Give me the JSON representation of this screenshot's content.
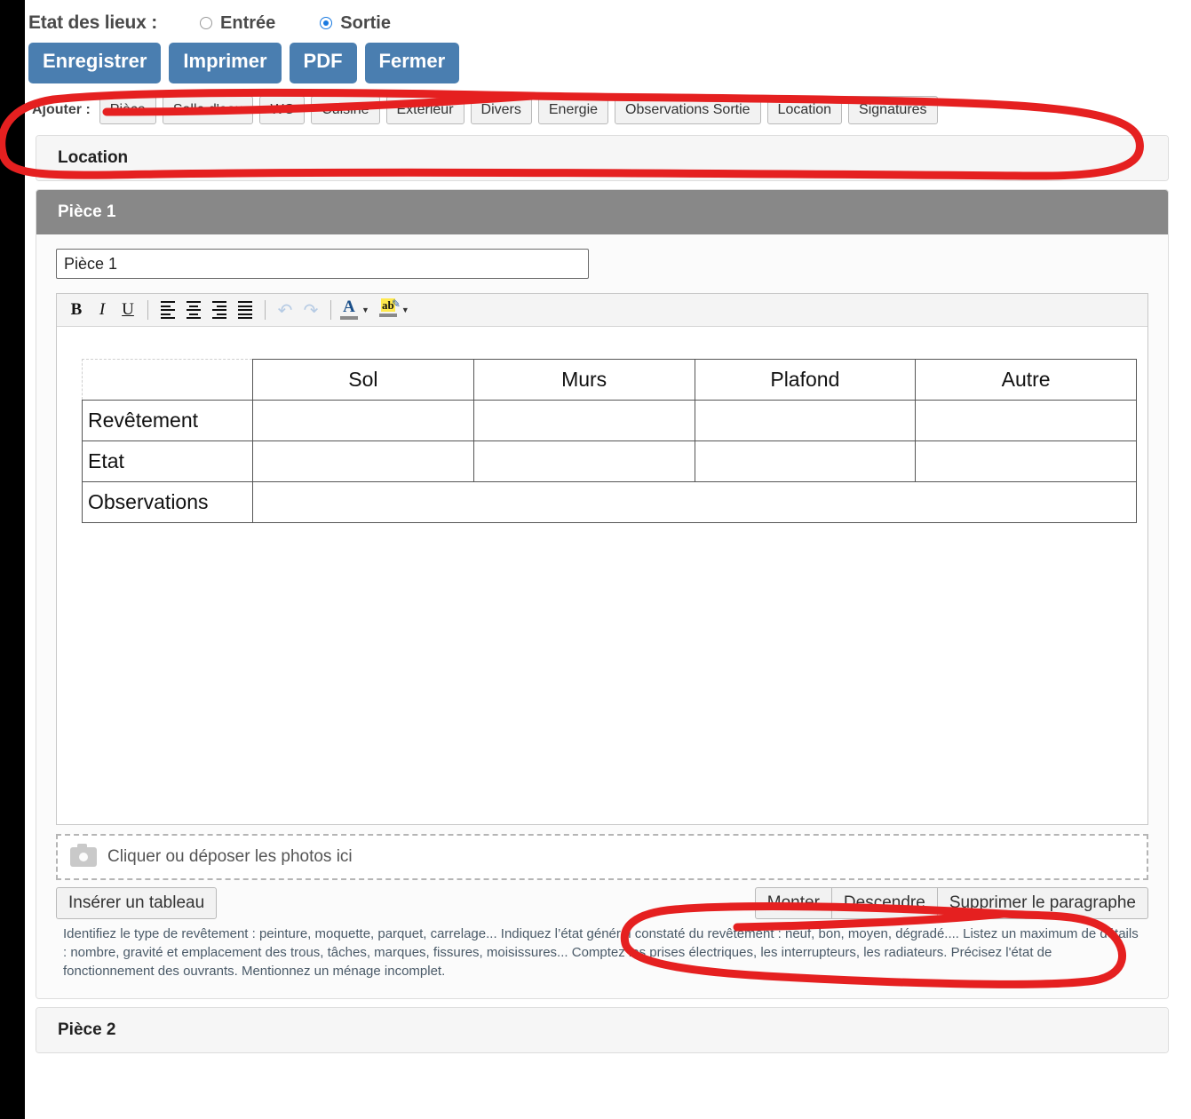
{
  "header": {
    "title": "Etat des lieux :",
    "radios": [
      {
        "label": "Entrée",
        "checked": false
      },
      {
        "label": "Sortie",
        "checked": true
      }
    ]
  },
  "actions": {
    "buttons": [
      "Enregistrer",
      "Imprimer",
      "PDF",
      "Fermer"
    ]
  },
  "add_bar": {
    "label": "Ajouter :",
    "buttons": [
      "Pièce",
      "Salle d'eau",
      "WC",
      "Cuisine",
      "Extérieur",
      "Divers",
      "Energie",
      "Observations Sortie",
      "Location",
      "Signatures"
    ]
  },
  "sections": {
    "location_title": "Location",
    "piece1_title": "Pièce 1",
    "piece2_title": "Pièce 2"
  },
  "piece1": {
    "name_value": "Pièce 1",
    "toolbar": {
      "bold": "B",
      "italic": "I",
      "underline": "U",
      "undo": "↶",
      "redo": "↷",
      "font_color_glyph": "A",
      "highlight_glyph": "ab",
      "dropdown_arrow": "▼"
    },
    "table": {
      "columns": [
        "",
        "Sol",
        "Murs",
        "Plafond",
        "Autre"
      ],
      "rows": [
        {
          "header": "Revêtement",
          "cells": [
            "",
            "",
            "",
            ""
          ]
        },
        {
          "header": "Etat",
          "cells": [
            "",
            "",
            "",
            ""
          ]
        },
        {
          "header": "Observations",
          "cells": [
            ""
          ]
        }
      ]
    },
    "dropzone_text": "Cliquer ou déposer les photos ici",
    "insert_table_label": "Insérer un tableau",
    "move_up_label": "Monter",
    "move_down_label": "Descendre",
    "delete_label": "Supprimer le paragraphe",
    "help_text": "Identifiez le type de revêtement : peinture, moquette, parquet, carrelage... Indiquez l’état général constaté du revêtement : neuf, bon, moyen, dégradé.... Listez un maximum de détails : nombre, gravité et emplacement des trous, tâches, marques, fissures, moisissures... Comptez les prises électriques, les interrupteurs, les radiateurs. Précisez l'état de fonctionnement des ouvrants. Mentionnez un ménage incomplet."
  },
  "colors": {
    "primary_button": "#4a7eb0",
    "section_header": "#888888",
    "radio_accent": "#1a7ae0",
    "annotation": "#e52020"
  }
}
